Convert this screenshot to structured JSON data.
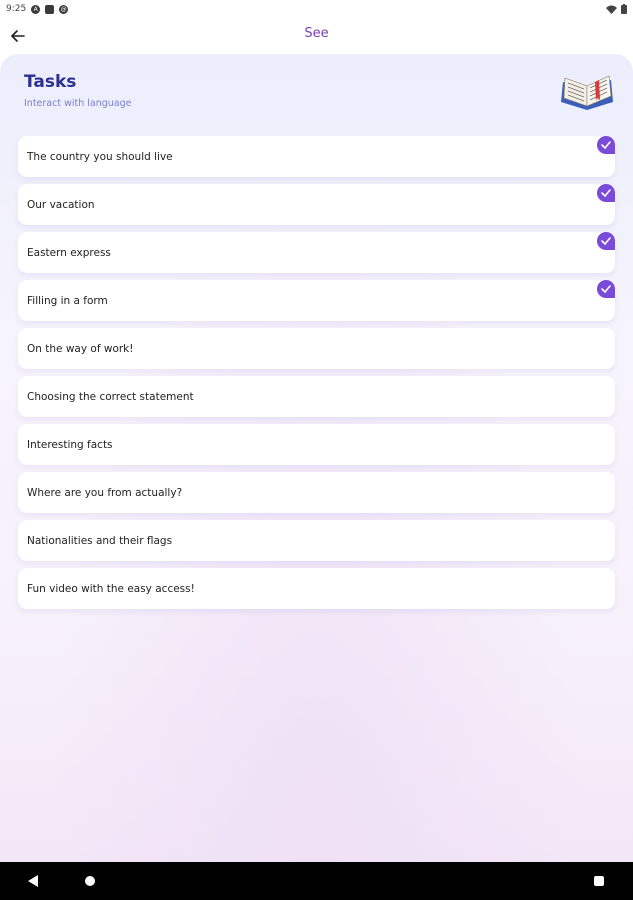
{
  "status_bar": {
    "time": "9:25"
  },
  "header": {
    "title": "See"
  },
  "section": {
    "title": "Tasks",
    "subtitle": "Interact with language"
  },
  "tasks": [
    {
      "label": "The country you should live",
      "completed": true
    },
    {
      "label": "Our vacation",
      "completed": true
    },
    {
      "label": "Eastern express",
      "completed": true
    },
    {
      "label": "Filling in a form",
      "completed": true
    },
    {
      "label": "On the way of work!",
      "completed": false
    },
    {
      "label": "Choosing the correct statement",
      "completed": false
    },
    {
      "label": "Interesting facts",
      "completed": false
    },
    {
      "label": "Where are you from actually?",
      "completed": false
    },
    {
      "label": "Nationalities and their flags",
      "completed": false
    },
    {
      "label": "Fun video with the easy access!",
      "completed": false
    }
  ],
  "colors": {
    "accent": "#7c4ad8",
    "title": "#2c2f8f",
    "header_title": "#7a3fb3",
    "subtitle": "#7b7fd0"
  },
  "icons": {
    "back": "arrow-left-icon",
    "book": "open-book-icon",
    "check": "checkmark-icon"
  }
}
